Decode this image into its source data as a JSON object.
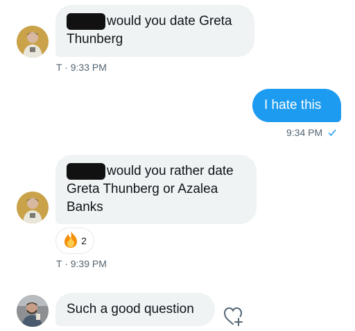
{
  "messages": [
    {
      "text": "would you date Greta",
      "text2": "Thunberg",
      "meta": "T · 9:33 PM"
    },
    {
      "text": "I hate this",
      "meta": "9:34 PM",
      "status_icon": "read-check-icon"
    },
    {
      "text": "would you rather date",
      "text2": "Greta Thunberg or Azalea",
      "text3": "Banks",
      "reaction": {
        "emoji": "fire-emoji",
        "count": "2"
      },
      "meta": "T · 9:39 PM"
    },
    {
      "text": "Such a good question",
      "action_icon": "add-reaction-heart-icon"
    }
  ],
  "colors": {
    "incoming_bubble": "#eff3f4",
    "outgoing_bubble": "#1d9bf0",
    "meta_text": "#536471"
  }
}
